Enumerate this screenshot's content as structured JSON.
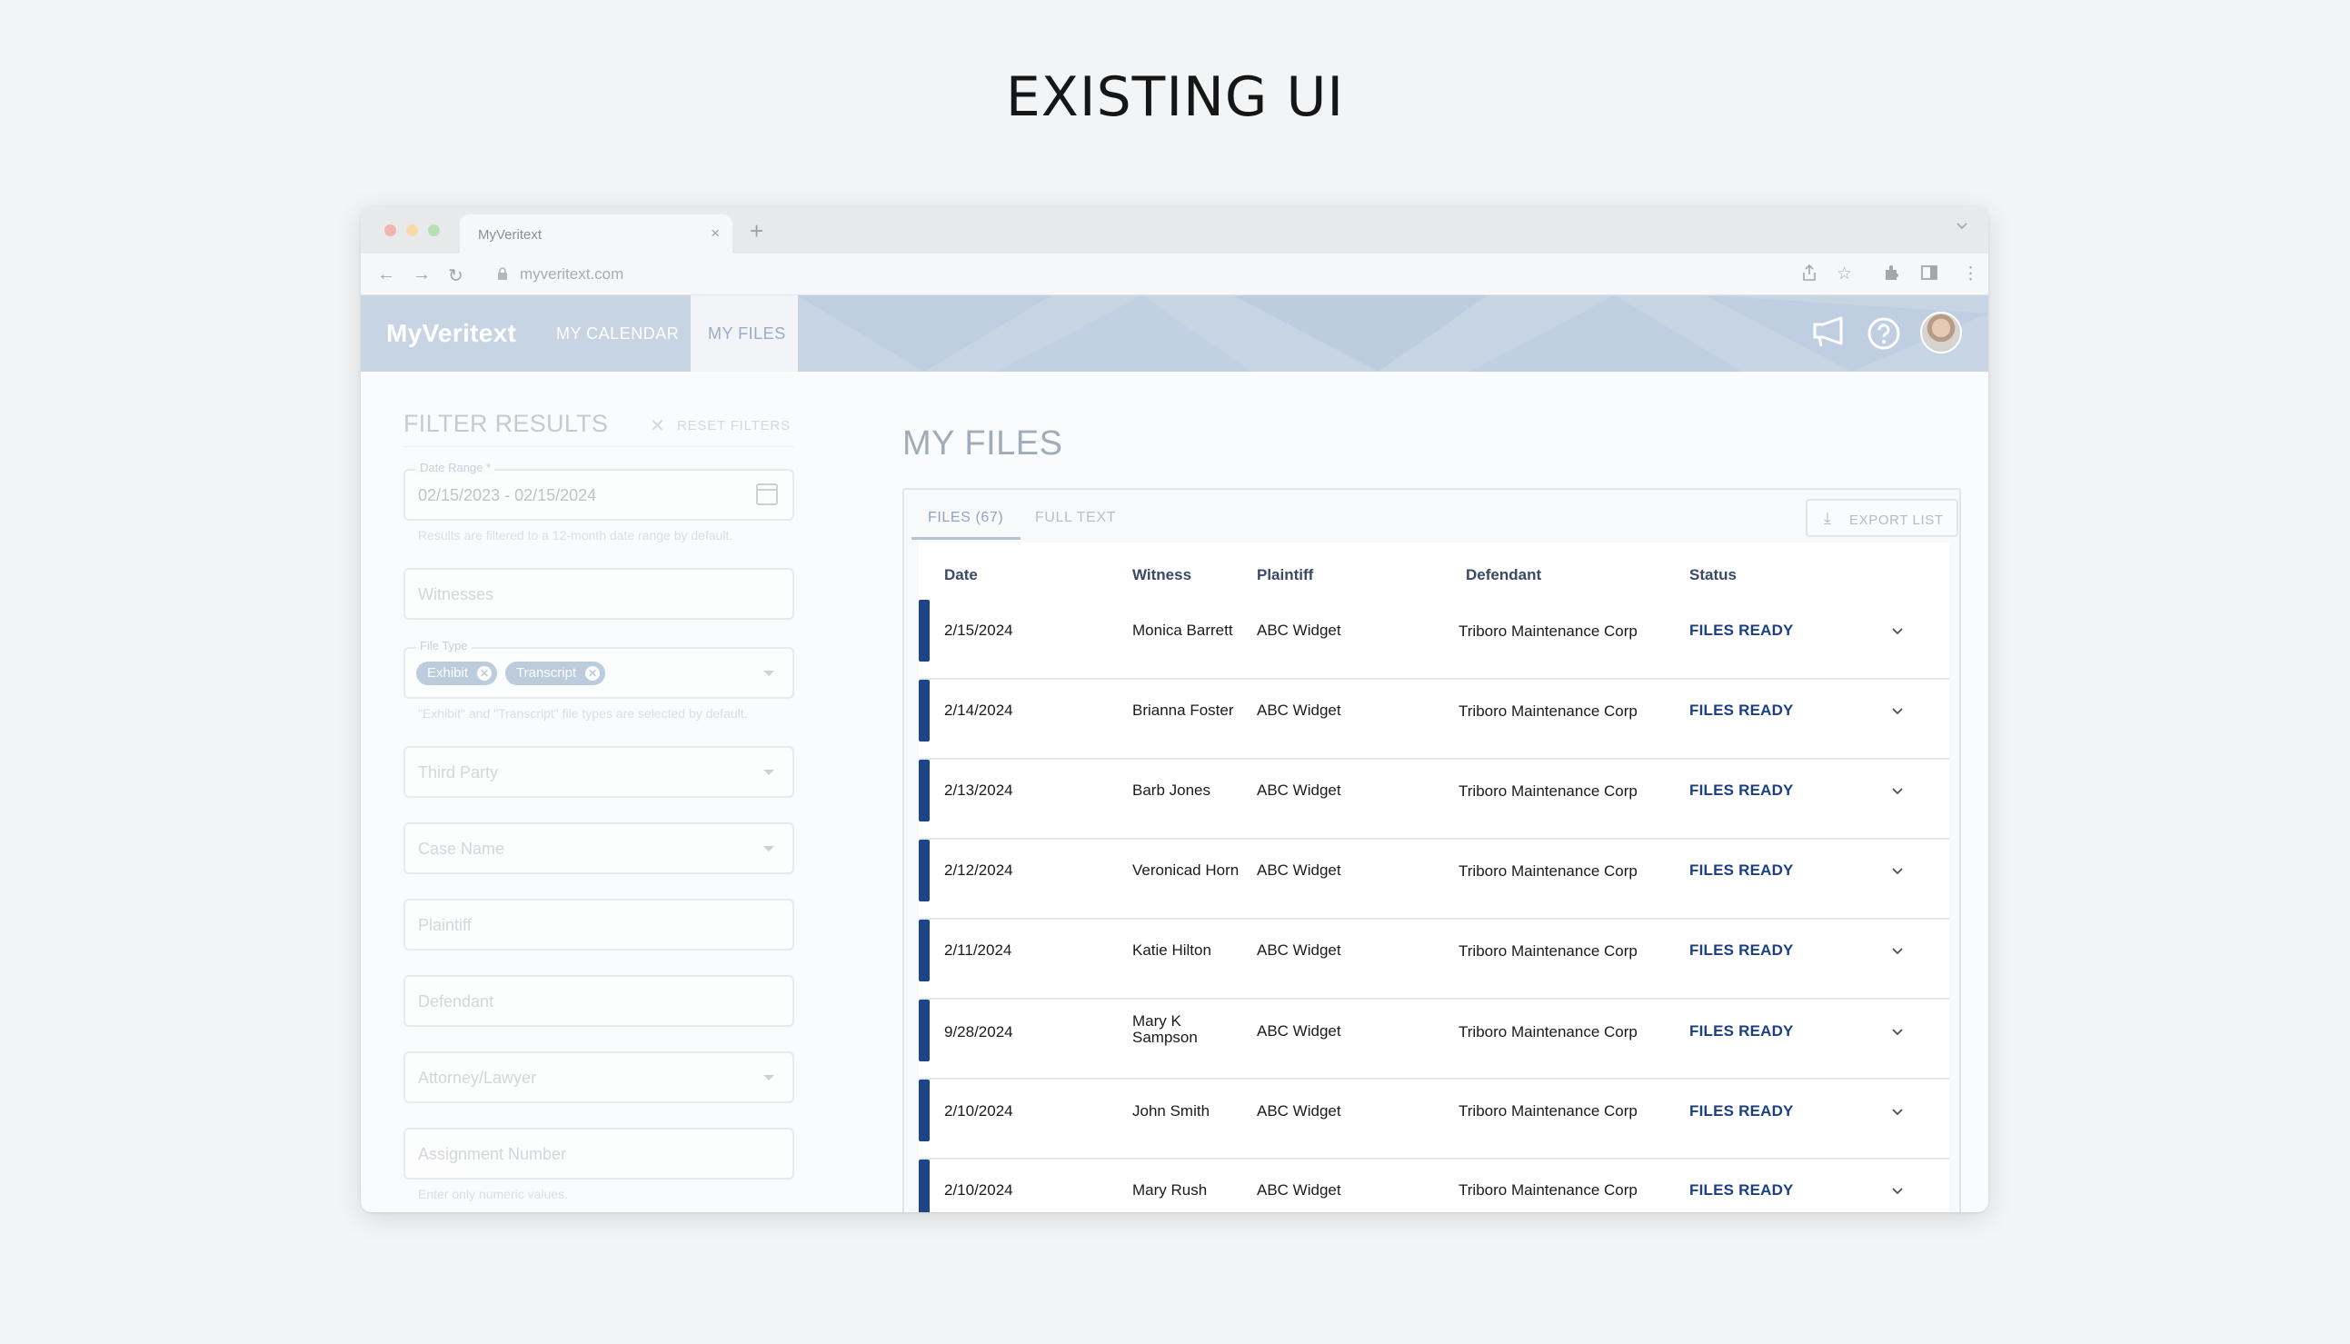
{
  "page": {
    "heading": "EXISTING UI"
  },
  "browser": {
    "tab_title": "MyVeritext",
    "tab_close": "×",
    "new_tab": "+",
    "url": "myveritext.com"
  },
  "app": {
    "logo": "MyVeritext",
    "nav": {
      "calendar": "MY CALENDAR",
      "files": "MY FILES"
    }
  },
  "filters": {
    "title": "FILTER RESULTS",
    "reset_label": "RESET FILTERS",
    "date_range": {
      "label": "Date Range *",
      "value": "02/15/2023 - 02/15/2024",
      "hint": "Results are filtered to a 12-month date range by default."
    },
    "witnesses_placeholder": "Witnesses",
    "file_type": {
      "label": "File Type",
      "chips": [
        "Exhibit",
        "Transcript"
      ],
      "hint": "\"Exhibit\" and \"Transcript\" file types are selected by default."
    },
    "third_party_placeholder": "Third Party",
    "case_name_placeholder": "Case Name",
    "plaintiff_placeholder": "Plaintiff",
    "defendant_placeholder": "Defendant",
    "attorney_placeholder": "Attorney/Lawyer",
    "assignment_placeholder": "Assignment Number",
    "assignment_hint": "Enter only numeric values."
  },
  "main": {
    "title": "MY FILES",
    "tabs": [
      "FILES (67)",
      "FULL TEXT"
    ],
    "export_label": "EXPORT LIST",
    "columns": [
      "Date",
      "Witness",
      "Plaintiff",
      "Defendant",
      "Status"
    ],
    "rows": [
      {
        "date": "2/15/2024",
        "witness": "Monica Barrett",
        "plaintiff": "ABC Widget",
        "defendant": "Triboro Maintenance Corp",
        "status": "FILES READY"
      },
      {
        "date": "2/14/2024",
        "witness": "Brianna Foster",
        "plaintiff": "ABC Widget",
        "defendant": "Triboro Maintenance Corp",
        "status": "FILES READY"
      },
      {
        "date": "2/13/2024",
        "witness": "Barb Jones",
        "plaintiff": "ABC Widget",
        "defendant": "Triboro Maintenance Corp",
        "status": "FILES READY"
      },
      {
        "date": "2/12/2024",
        "witness": "Veronicad Horn",
        "plaintiff": "ABC Widget",
        "defendant": "Triboro Maintenance Corp",
        "status": "FILES READY"
      },
      {
        "date": "2/11/2024",
        "witness": "Katie Hilton",
        "plaintiff": "ABC Widget",
        "defendant": "Triboro Maintenance Corp",
        "status": "FILES READY"
      },
      {
        "date": "9/28/2024",
        "witness": "Mary K Sampson",
        "witness_l1": "Mary K",
        "witness_l2": "Sampson",
        "plaintiff": "ABC Widget",
        "defendant": "Triboro Maintenance Corp",
        "status": "FILES READY"
      },
      {
        "date": "2/10/2024",
        "witness": "John Smith",
        "plaintiff": "ABC Widget",
        "defendant": "Triboro Maintenance Corp",
        "status": "FILES READY"
      },
      {
        "date": "2/10/2024",
        "witness": "Mary Rush",
        "plaintiff": "ABC Widget",
        "defendant": "Triboro Maintenance Corp",
        "status": "FILES READY"
      }
    ]
  },
  "colors": {
    "accent_bar": "#1c4487",
    "status": "#1d3f82",
    "header_bg": "#c6d4e4"
  },
  "icons": [
    "back-icon",
    "forward-icon",
    "reload-icon",
    "lock-icon",
    "share-icon",
    "star-icon",
    "extensions-icon",
    "sidebar-icon",
    "more-icon",
    "megaphone-icon",
    "help-icon",
    "calendar-icon",
    "download-icon",
    "chevron-down-icon",
    "close-icon"
  ]
}
